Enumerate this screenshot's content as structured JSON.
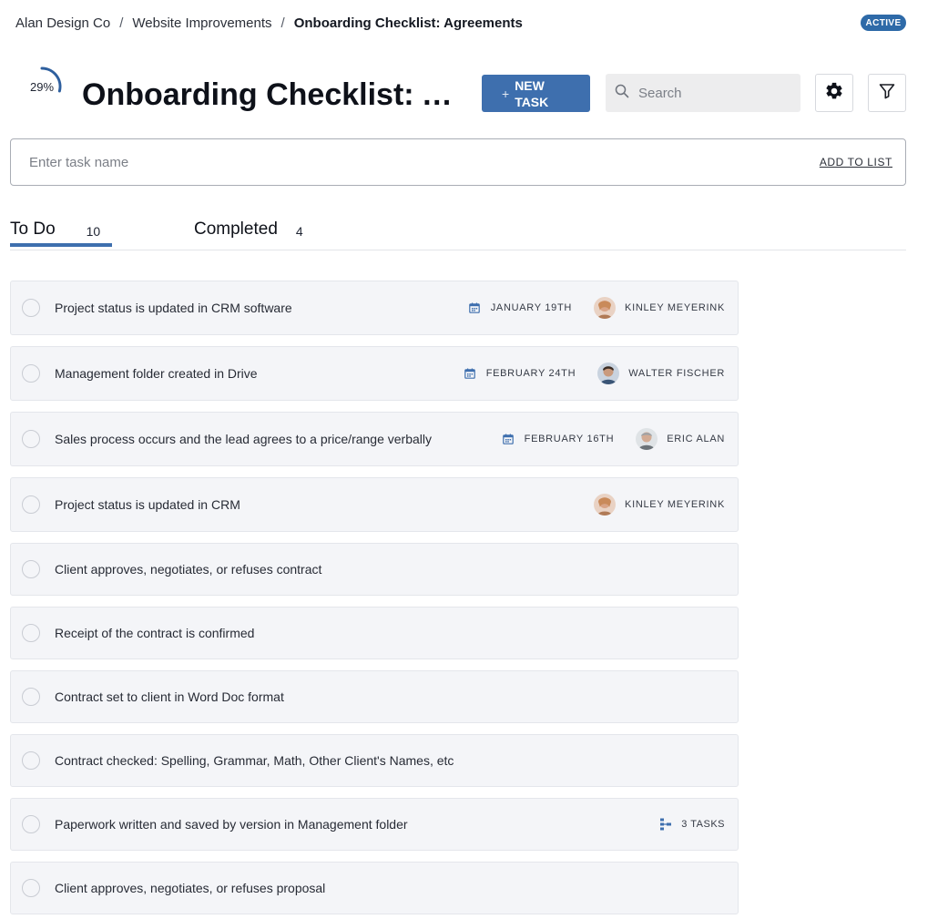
{
  "breadcrumb": {
    "items": [
      "Alan Design Co",
      "Website Improvements"
    ],
    "current": "Onboarding Checklist: Agreements",
    "separator": "/"
  },
  "status_badge": "ACTIVE",
  "progress": {
    "percent": 29,
    "label": "29%"
  },
  "page_title": "Onboarding Checklist: Agreements",
  "toolbar": {
    "new_task_label": "NEW TASK",
    "search_placeholder": "Search"
  },
  "add_task": {
    "placeholder": "Enter task name",
    "action_label": "ADD TO LIST"
  },
  "tabs": [
    {
      "label": "To Do",
      "count": "10"
    },
    {
      "label": "Completed",
      "count": "4"
    }
  ],
  "colors": {
    "accent": "#3e6fae",
    "badge": "#2e6aa8",
    "row_bg": "#f4f5f8"
  },
  "tasks": [
    {
      "title": "Project status is updated in CRM software",
      "date": "JANUARY 19TH",
      "assignee": "KINLEY MEYERINK",
      "avatar": "kinley"
    },
    {
      "title": "Management folder created in Drive",
      "date": "FEBRUARY 24TH",
      "assignee": "WALTER FISCHER",
      "avatar": "walter"
    },
    {
      "title": "Sales process occurs and the lead agrees to a price/range verbally",
      "date": "FEBRUARY 16TH",
      "assignee": "ERIC ALAN",
      "avatar": "eric"
    },
    {
      "title": "Project status is updated in CRM",
      "date": "",
      "assignee": "KINLEY MEYERINK",
      "avatar": "kinley"
    },
    {
      "title": "Client approves, negotiates, or refuses contract",
      "date": "",
      "assignee": ""
    },
    {
      "title": "Receipt of the contract is confirmed",
      "date": "",
      "assignee": ""
    },
    {
      "title": "Contract set to client in Word Doc format",
      "date": "",
      "assignee": ""
    },
    {
      "title": "Contract checked: Spelling, Grammar, Math, Other Client's Names, etc",
      "date": "",
      "assignee": ""
    },
    {
      "title": "Paperwork written and saved by version in Management folder",
      "date": "",
      "assignee": "",
      "subtasks": "3 TASKS"
    },
    {
      "title": "Client approves, negotiates, or refuses proposal",
      "date": "",
      "assignee": ""
    }
  ]
}
